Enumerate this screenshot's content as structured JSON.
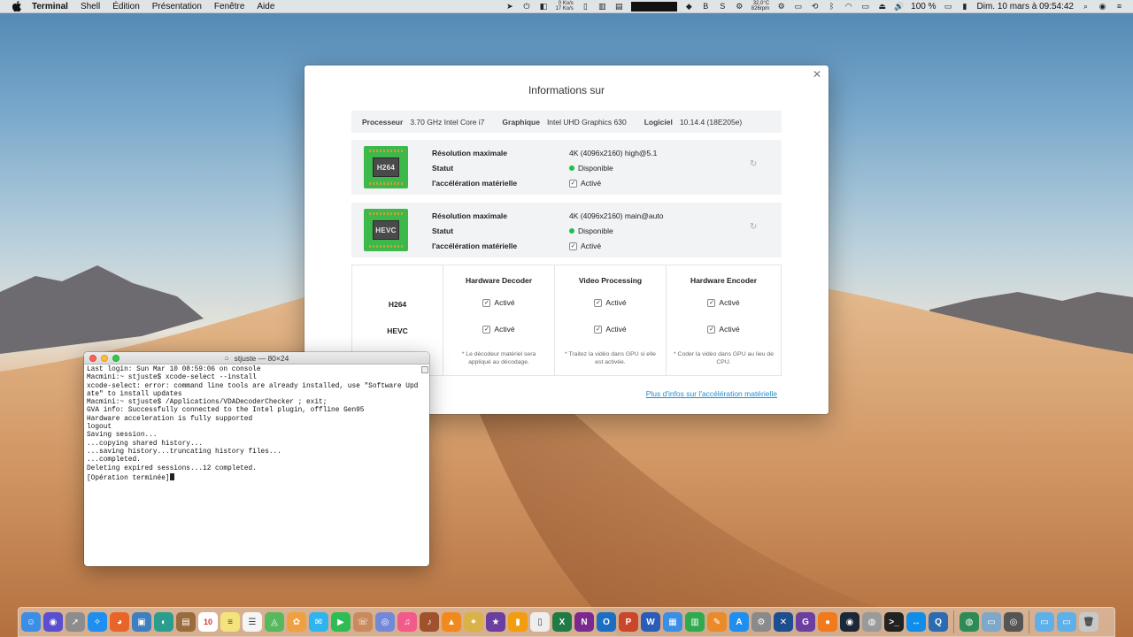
{
  "menubar": {
    "app_name": "Terminal",
    "menus": [
      "Shell",
      "Édition",
      "Présentation",
      "Fenêtre",
      "Aide"
    ],
    "net_up": "0 Ko/s",
    "net_down": "17 Ko/s",
    "temperature": "32,0°C",
    "fan_speed": "826rpm",
    "battery": "100 %",
    "clock": "Dim. 10 mars à  09:54:42"
  },
  "info_window": {
    "title": "Informations sur",
    "specs": {
      "processor_label": "Processeur",
      "processor_value": "3.70 GHz Intel Core i7",
      "graphics_label": "Graphique",
      "graphics_value": "Intel UHD Graphics 630",
      "software_label": "Logiciel",
      "software_value": "10.14.4 (18E205e)"
    },
    "codecs": [
      {
        "chip_label": "H264",
        "resolution_label": "Résolution maximale",
        "resolution_value": "4K (4096x2160) high@5.1",
        "status_label": "Statut",
        "status_value": "Disponible",
        "accel_label": "l'accélération matérielle",
        "accel_value": "Activé"
      },
      {
        "chip_label": "HEVC",
        "resolution_label": "Résolution maximale",
        "resolution_value": "4K (4096x2160) main@auto",
        "status_label": "Statut",
        "status_value": "Disponible",
        "accel_label": "l'accélération matérielle",
        "accel_value": "Activé"
      }
    ],
    "table": {
      "row_labels": [
        "H264",
        "HEVC"
      ],
      "columns": [
        {
          "header": "Hardware Decoder",
          "h264": "Activé",
          "hevc": "Activé",
          "note": "* Le décodeur matériel sera appliqué au décodage."
        },
        {
          "header": "Video Processing",
          "h264": "Activé",
          "hevc": "Activé",
          "note": "* Traitez la vidéo dans GPU si elle est activée."
        },
        {
          "header": "Hardware Encoder",
          "h264": "Activé",
          "hevc": "Activé",
          "note": "* Coder la vidéo dans GPU au lieu de CPU."
        }
      ]
    },
    "more_link": "Plus d'infos sur l'accélération matérielle"
  },
  "terminal": {
    "title": "stjuste — 80×24",
    "lines": [
      "Last login: Sun Mar 10 08:59:06 on console",
      "Macmini:~ stjuste$ xcode-select --install",
      "xcode-select: error: command line tools are already installed, use \"Software Upd",
      "ate\" to install updates",
      "Macmini:~ stjuste$ /Applications/VDADecoderChecker ; exit;",
      "GVA info: Successfully connected to the Intel plugin, offline Gen95",
      "Hardware acceleration is fully supported",
      "logout",
      "Saving session...",
      "...copying shared history...",
      "...saving history...truncating history files...",
      "...completed.",
      "Deleting expired sessions...12 completed.",
      "",
      "[Opération terminée]"
    ]
  },
  "dock": {
    "badge_mail": "388",
    "badge_outlook": "49323",
    "calendar_day": "10",
    "apps": [
      {
        "name": "finder-icon",
        "color": "#3a8ee6",
        "glyph": "☺"
      },
      {
        "name": "siri-icon",
        "color": "#5a4fcf",
        "glyph": "◉"
      },
      {
        "name": "launchpad-icon",
        "color": "#8d8d8d",
        "glyph": "➚"
      },
      {
        "name": "safari-icon",
        "color": "#1e8ff0",
        "glyph": "✧"
      },
      {
        "name": "firefox-icon",
        "color": "#e8652a",
        "glyph": "◕"
      },
      {
        "name": "preview-icon",
        "color": "#3f7fbf",
        "glyph": "▣"
      },
      {
        "name": "photo-icon",
        "color": "#2a9d8f",
        "glyph": "◐"
      },
      {
        "name": "notes-brown-icon",
        "color": "#9a6b3d",
        "glyph": "▤"
      },
      {
        "name": "calendar-icon",
        "color": "#ffffff",
        "glyph": "10"
      },
      {
        "name": "notes-icon",
        "color": "#f4e27a",
        "glyph": "≡"
      },
      {
        "name": "reminders-icon",
        "color": "#f5f5f5",
        "glyph": "☰"
      },
      {
        "name": "maps-icon",
        "color": "#57b85d",
        "glyph": "◬"
      },
      {
        "name": "photos-icon",
        "color": "#f0a040",
        "glyph": "✿"
      },
      {
        "name": "messages-icon",
        "color": "#30b4f0",
        "glyph": "✉"
      },
      {
        "name": "facetime-icon",
        "color": "#2ebd55",
        "glyph": "▶"
      },
      {
        "name": "contacts-icon",
        "color": "#c98a5e",
        "glyph": "☏"
      },
      {
        "name": "discord-icon",
        "color": "#7289da",
        "glyph": "◎"
      },
      {
        "name": "itunes-icon",
        "color": "#f15a8a",
        "glyph": "♫"
      },
      {
        "name": "guitar-icon",
        "color": "#a0522d",
        "glyph": "♪"
      },
      {
        "name": "vlc-icon",
        "color": "#f08a1c",
        "glyph": "▲"
      },
      {
        "name": "pineapple-icon",
        "color": "#d9b24a",
        "glyph": "✦"
      },
      {
        "name": "imovie-icon",
        "color": "#6b3fa0",
        "glyph": "★"
      },
      {
        "name": "books-icon",
        "color": "#f39c12",
        "glyph": "▮"
      },
      {
        "name": "pages-icon",
        "color": "#eeeeee",
        "glyph": "▯"
      },
      {
        "name": "excel-icon",
        "color": "#1f7a45",
        "glyph": "X"
      },
      {
        "name": "onenote-icon",
        "color": "#7a2a8f",
        "glyph": "N"
      },
      {
        "name": "outlook-icon",
        "color": "#1a6fc4",
        "glyph": "O"
      },
      {
        "name": "powerpoint-icon",
        "color": "#c9472a",
        "glyph": "P"
      },
      {
        "name": "word-icon",
        "color": "#2b5cb8",
        "glyph": "W"
      },
      {
        "name": "keynote-icon",
        "color": "#3a8ee6",
        "glyph": "▦"
      },
      {
        "name": "numbers-icon",
        "color": "#2faa4f",
        "glyph": "▥"
      },
      {
        "name": "pages-doc-icon",
        "color": "#e98b2b",
        "glyph": "✎"
      },
      {
        "name": "appstore-icon",
        "color": "#1e8ff0",
        "glyph": "A"
      },
      {
        "name": "prefs-icon",
        "color": "#8a8a8a",
        "glyph": "⚙"
      },
      {
        "name": "xcode-icon",
        "color": "#1d4e8f",
        "glyph": "✕"
      },
      {
        "name": "gog-icon",
        "color": "#6b3fa0",
        "glyph": "G"
      },
      {
        "name": "orange-app-icon",
        "color": "#f07a1c",
        "glyph": "●"
      },
      {
        "name": "steam-icon",
        "color": "#1b2838",
        "glyph": "◉"
      },
      {
        "name": "disk-utility-icon",
        "color": "#9a9a9a",
        "glyph": "◍"
      },
      {
        "name": "terminal-icon",
        "color": "#222222",
        "glyph": ">_"
      },
      {
        "name": "teamviewer-icon",
        "color": "#0e8ee9",
        "glyph": "↔"
      },
      {
        "name": "quicktime-icon",
        "color": "#2b6cb0",
        "glyph": "Q"
      },
      {
        "name": "globe-icon",
        "color": "#2e8b57",
        "glyph": "◍"
      },
      {
        "name": "folder-app-icon",
        "color": "#7fa7c9",
        "glyph": "▭"
      },
      {
        "name": "film-icon",
        "color": "#555555",
        "glyph": "◎"
      },
      {
        "name": "downloads-folder-icon",
        "color": "#5fb0e8",
        "glyph": "▭"
      },
      {
        "name": "documents-folder-icon",
        "color": "#5fb0e8",
        "glyph": "▭"
      },
      {
        "name": "trash-icon",
        "color": "#c8c8c8",
        "glyph": "🗑"
      }
    ]
  }
}
